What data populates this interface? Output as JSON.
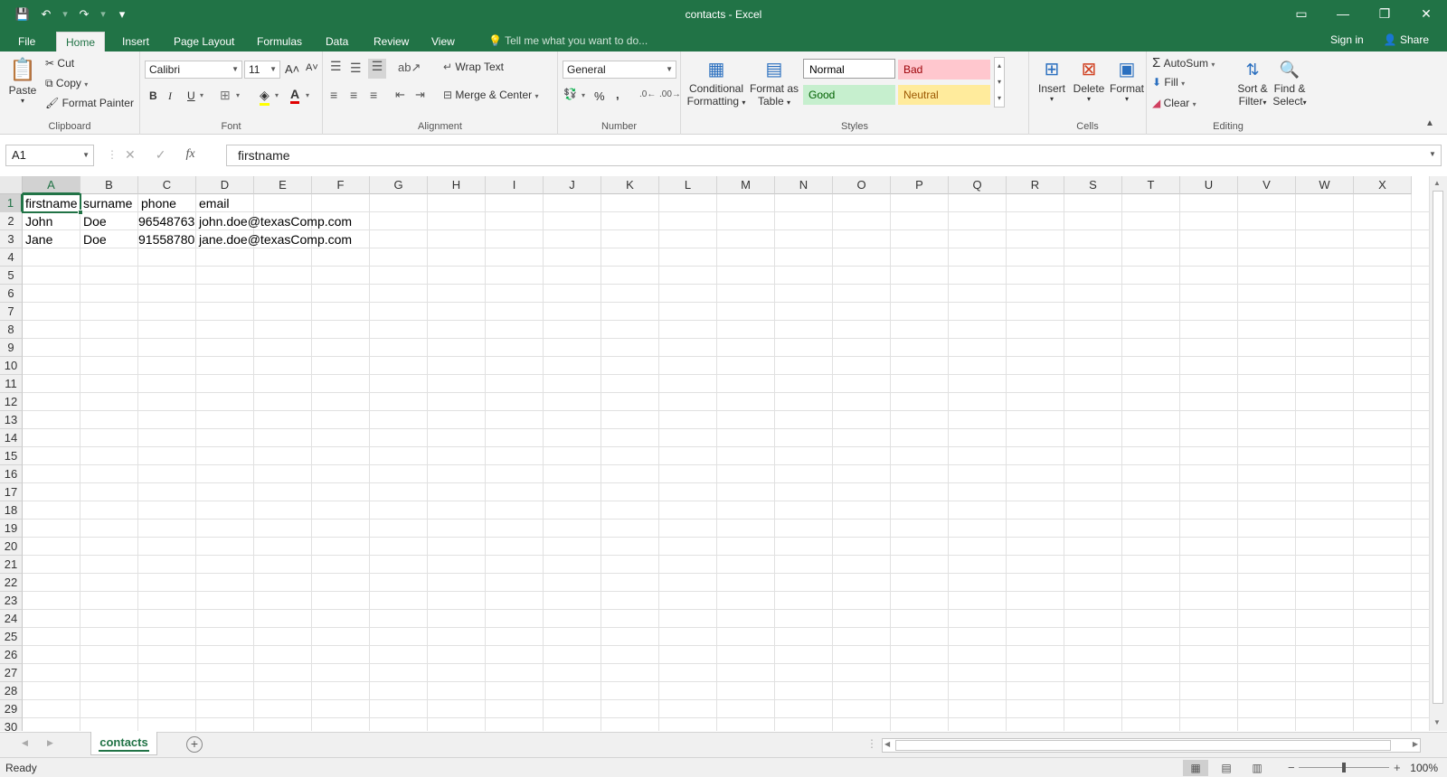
{
  "window": {
    "title": "contacts - Excel",
    "qat": {
      "save_icon": "💾",
      "undo_icon": "↶",
      "redo_icon": "↷",
      "customize_icon": "▾"
    },
    "controls": {
      "ribbon_display": "▭",
      "minimize": "—",
      "restore": "❐",
      "close": "✕"
    }
  },
  "tabs": [
    {
      "label": "File"
    },
    {
      "label": "Home"
    },
    {
      "label": "Insert"
    },
    {
      "label": "Page Layout"
    },
    {
      "label": "Formulas"
    },
    {
      "label": "Data"
    },
    {
      "label": "Review"
    },
    {
      "label": "View"
    }
  ],
  "tell_me": "Tell me what you want to do...",
  "account": {
    "sign_in": "Sign in",
    "share": "Share"
  },
  "ribbon": {
    "clipboard": {
      "label": "Clipboard",
      "paste": "Paste",
      "cut": "Cut",
      "copy": "Copy",
      "format_painter": "Format Painter"
    },
    "font": {
      "label": "Font",
      "name": "Calibri",
      "size": "11",
      "bold": "B",
      "italic": "I",
      "underline": "U",
      "grow": "A˄",
      "shrink": "A˅"
    },
    "alignment": {
      "label": "Alignment",
      "wrap_text": "Wrap Text",
      "merge_center": "Merge & Center"
    },
    "number": {
      "label": "Number",
      "format": "General",
      "percent": "%",
      "comma": ","
    },
    "styles": {
      "label": "Styles",
      "conditional": "Conditional",
      "conditional2": "Formatting",
      "format_as": "Format as",
      "format_as2": "Table",
      "normal": "Normal",
      "bad": "Bad",
      "good": "Good",
      "neutral": "Neutral"
    },
    "cells": {
      "label": "Cells",
      "insert": "Insert",
      "delete": "Delete",
      "format": "Format"
    },
    "editing": {
      "label": "Editing",
      "autosum": "AutoSum",
      "fill": "Fill",
      "clear": "Clear",
      "sort": "Sort &",
      "sort2": "Filter",
      "find": "Find &",
      "find2": "Select"
    }
  },
  "formula_bar": {
    "name_box": "A1",
    "fx_label": "fx",
    "value": "firstname"
  },
  "grid": {
    "columns": [
      "A",
      "B",
      "C",
      "D",
      "E",
      "F",
      "G",
      "H",
      "I",
      "J",
      "K",
      "L",
      "M",
      "N",
      "O",
      "P",
      "Q",
      "R",
      "S",
      "T",
      "U",
      "V",
      "W",
      "X"
    ],
    "rows": [
      "1",
      "2",
      "3",
      "4",
      "5",
      "6",
      "7",
      "8",
      "9",
      "10",
      "11",
      "12",
      "13",
      "14",
      "15",
      "16",
      "17",
      "18",
      "19",
      "20",
      "21",
      "22",
      "23",
      "24",
      "25",
      "26",
      "27",
      "28",
      "29",
      "30"
    ],
    "cells": {
      "r1": [
        "firstname",
        "surname",
        "phone",
        "email"
      ],
      "r2": [
        "John",
        "Doe",
        "96548763",
        "john.doe@texasComp.com"
      ],
      "r3": [
        "Jane",
        "Doe",
        "91558780",
        "jane.doe@texasComp.com"
      ]
    },
    "active_cell": "A1"
  },
  "sheet": {
    "name": "contacts",
    "add": "+"
  },
  "status": {
    "text": "Ready",
    "zoom": "100%",
    "zoom_out": "−",
    "zoom_in": "+"
  },
  "colors": {
    "accent": "#217346",
    "bad_bg": "#ffc7ce",
    "bad_fg": "#9c0006",
    "good_bg": "#c6efce",
    "good_fg": "#006100",
    "neutral_bg": "#ffeb9c",
    "neutral_fg": "#9c5700"
  }
}
